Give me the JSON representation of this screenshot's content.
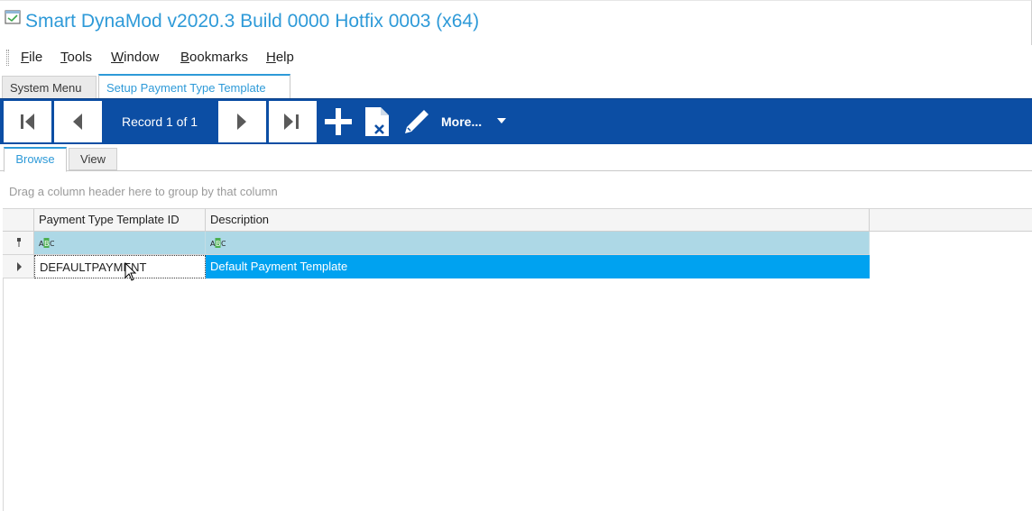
{
  "window": {
    "title": "Smart DynaMod v2020.3 Build 0000 Hotfix 0003 (x64)",
    "icon": "app-logo-icon"
  },
  "menu": {
    "items": [
      {
        "label": "File",
        "mnemonic": "F",
        "rest": "ile"
      },
      {
        "label": "Tools",
        "mnemonic": "T",
        "rest": "ools"
      },
      {
        "label": "Window",
        "mnemonic": "W",
        "rest": "indow"
      },
      {
        "label": "Bookmarks",
        "mnemonic": "B",
        "rest": "ookmarks"
      },
      {
        "label": "Help",
        "mnemonic": "H",
        "rest": "elp"
      }
    ]
  },
  "doc_tabs": [
    {
      "label": "System Menu",
      "active": false
    },
    {
      "label": "Setup Payment Type Template",
      "active": true
    }
  ],
  "toolbar": {
    "record_label": "Record 1 of 1",
    "more_label": "More...",
    "icons": [
      "first-record-icon",
      "previous-record-icon",
      "next-record-icon",
      "last-record-icon",
      "add-icon",
      "delete-icon",
      "edit-icon",
      "dropdown-caret-icon"
    ],
    "colors": {
      "background": "#0c4ea4",
      "text": "#ffffff"
    }
  },
  "sub_tabs": [
    {
      "label": "Browse",
      "active": true
    },
    {
      "label": "View",
      "active": false
    }
  ],
  "grid": {
    "group_hint": "Drag a column header here to group by that column",
    "columns": [
      "Payment Type Template ID",
      "Description"
    ],
    "rows": [
      {
        "id": "DEFAULTPAYMENT",
        "description": "Default Payment Template",
        "selected": true
      }
    ],
    "colors": {
      "filter_row": "#add8e6",
      "selection": "#00a2f0",
      "accent": "#2e9ad8"
    }
  }
}
